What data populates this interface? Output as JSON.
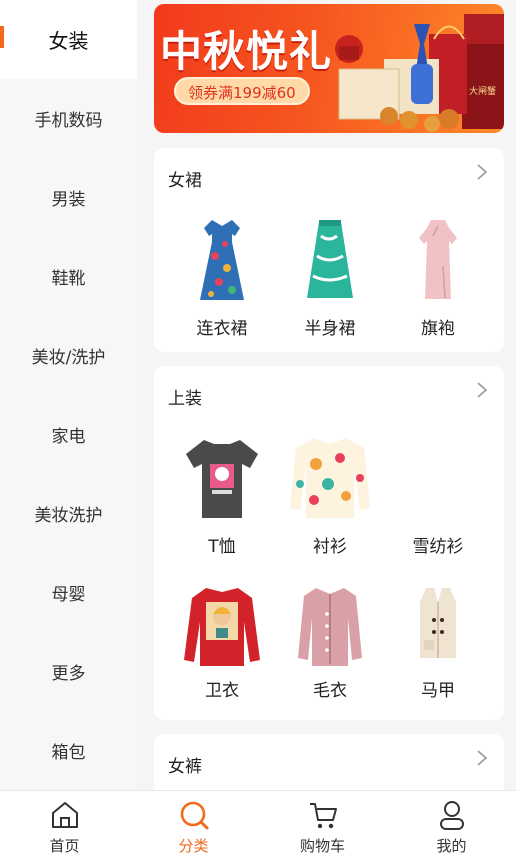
{
  "sidebar": {
    "items": [
      {
        "label": "女装",
        "active": true
      },
      {
        "label": "手机数码"
      },
      {
        "label": "男装"
      },
      {
        "label": "鞋靴"
      },
      {
        "label": "美妆/洗护"
      },
      {
        "label": "家电"
      },
      {
        "label": "美妆洗护"
      },
      {
        "label": "母婴"
      },
      {
        "label": "更多"
      },
      {
        "label": "箱包"
      }
    ]
  },
  "banner": {
    "title": "中秋悦礼",
    "coupon": "领券满199减60"
  },
  "sections": [
    {
      "title": "女裙",
      "items": [
        {
          "label": "连衣裙",
          "icon": "floral-dress-image"
        },
        {
          "label": "半身裙",
          "icon": "green-skirt-image"
        },
        {
          "label": "旗袍",
          "icon": "pink-qipao-image"
        }
      ]
    },
    {
      "title": "上装",
      "items": [
        {
          "label": "T恤",
          "icon": "graphic-tshirt-image"
        },
        {
          "label": "衬衫",
          "icon": "floral-shirt-image"
        },
        {
          "label": "雪纺衫",
          "icon": "chiffon-blouse-image"
        },
        {
          "label": "卫衣",
          "icon": "red-sweatshirt-image"
        },
        {
          "label": "毛衣",
          "icon": "pink-cardigan-image"
        },
        {
          "label": "马甲",
          "icon": "beige-vest-image"
        }
      ]
    },
    {
      "title": "女裤",
      "items": []
    }
  ],
  "tabbar": {
    "items": [
      {
        "label": "首页",
        "icon": "home-icon"
      },
      {
        "label": "分类",
        "icon": "category-search-icon",
        "active": true
      },
      {
        "label": "购物车",
        "icon": "cart-icon"
      },
      {
        "label": "我的",
        "icon": "profile-icon"
      }
    ]
  },
  "colors": {
    "accent": "#f26b1d",
    "banner_red": "#f23a1d"
  }
}
